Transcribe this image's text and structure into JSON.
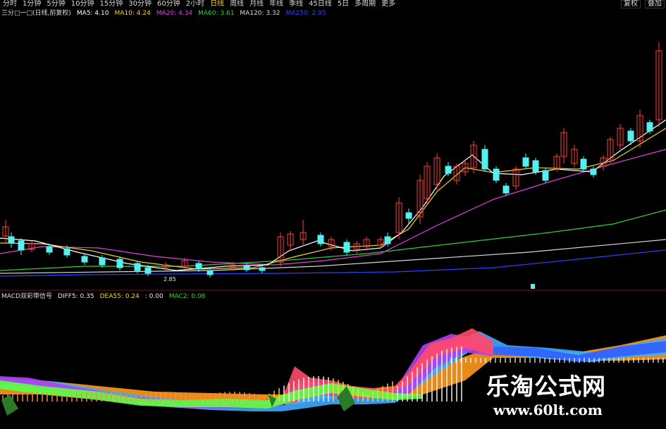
{
  "toolbar": {
    "periods": [
      "分时",
      "1分钟",
      "5分钟",
      "10分钟",
      "15分钟",
      "30分钟",
      "60分钟",
      "2小时",
      "日线",
      "周线",
      "月线",
      "年线",
      "季线",
      "45日线",
      "5日",
      "多周期",
      "更多"
    ],
    "active_index": 8,
    "right_buttons": [
      "复权",
      "叠加"
    ]
  },
  "main_legend": {
    "title": "三分□一□(日线,前复权)",
    "items": [
      {
        "label": "MA5: 4.10",
        "color": "#ffffff"
      },
      {
        "label": "MA10: 4.24",
        "color": "#f2d21c"
      },
      {
        "label": "MA20: 4.34",
        "color": "#e040e0"
      },
      {
        "label": "MA60: 3.61",
        "color": "#30d030"
      },
      {
        "label": "MA120: 3.32",
        "color": "#d8d8d8"
      },
      {
        "label": "MA250: 2.95",
        "color": "#3040ff"
      }
    ]
  },
  "price_label": "2.85",
  "macd_legend": {
    "title": "MACD双彩带信号",
    "items": [
      {
        "label": "DIFF5: 0.35",
        "color": "#e8e8e8"
      },
      {
        "label": "DEA55: 0.24",
        "color": "#f2d21c"
      },
      {
        "label": ": 0.00",
        "color": "#e8e8e8"
      },
      {
        "label": "MAC2: 0.08",
        "color": "#30d030"
      }
    ]
  },
  "watermark": {
    "line1": "乐淘公式网",
    "line2": "www.60lt.com"
  },
  "colors": {
    "up": "#ff3b3b",
    "down": "#54f0f0",
    "ma5": "#ffffff",
    "ma10": "#f2d21c",
    "ma20": "#e040e0",
    "ma60": "#30d030",
    "ma120": "#d8d8d8",
    "ma250": "#3040ff"
  }
}
